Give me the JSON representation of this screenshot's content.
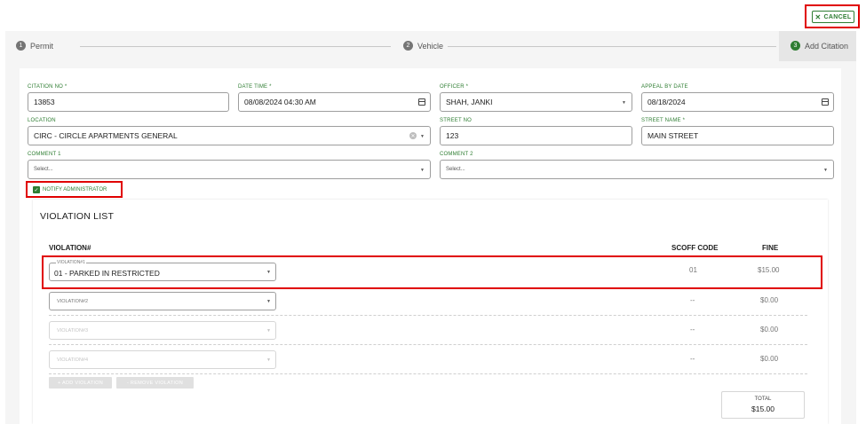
{
  "header": {
    "cancel_label": "CANCEL"
  },
  "stepper": {
    "steps": [
      {
        "num": "1",
        "label": "Permit"
      },
      {
        "num": "2",
        "label": "Vehicle"
      },
      {
        "num": "3",
        "label": "Add Citation"
      }
    ]
  },
  "form": {
    "citation_no": {
      "label": "CITATION NO *",
      "value": "13853"
    },
    "date_time": {
      "label": "DATE TIME *",
      "value": "08/08/2024 04:30 AM"
    },
    "officer": {
      "label": "OFFICER *",
      "value": "SHAH, JANKI"
    },
    "appeal_by_date": {
      "label": "APPEAL BY DATE",
      "value": "08/18/2024"
    },
    "location": {
      "label": "LOCATION",
      "value": "CIRC - CIRCLE APARTMENTS GENERAL"
    },
    "street_no": {
      "label": "STREET NO",
      "value": "123"
    },
    "street_name": {
      "label": "STREET NAME *",
      "value": "MAIN STREET"
    },
    "comment1": {
      "label": "COMMENT 1",
      "placeholder": "Select..."
    },
    "comment2": {
      "label": "COMMENT 2",
      "placeholder": "Select..."
    },
    "notify_label": "NOTIFY ADMINISTRATOR"
  },
  "violations": {
    "title": "VIOLATION LIST",
    "headers": {
      "violation": "VIOLATION#",
      "scoff": "SCOFF CODE",
      "fine": "FINE"
    },
    "rows": [
      {
        "label": "VIOLATION#1",
        "value": "01 - PARKED IN RESTRICTED",
        "scoff": "01",
        "fine": "$15.00"
      },
      {
        "label": "VIOLATION#2",
        "value": "",
        "scoff": "--",
        "fine": "$0.00"
      },
      {
        "label": "VIOLATION#3",
        "value": "",
        "scoff": "--",
        "fine": "$0.00"
      },
      {
        "label": "VIOLATION#4",
        "value": "",
        "scoff": "--",
        "fine": "$0.00"
      }
    ],
    "add_label": "+ ADD VIOLATION",
    "remove_label": "- REMOVE VIOLATION",
    "total_label": "TOTAL",
    "total_value": "$15.00"
  }
}
